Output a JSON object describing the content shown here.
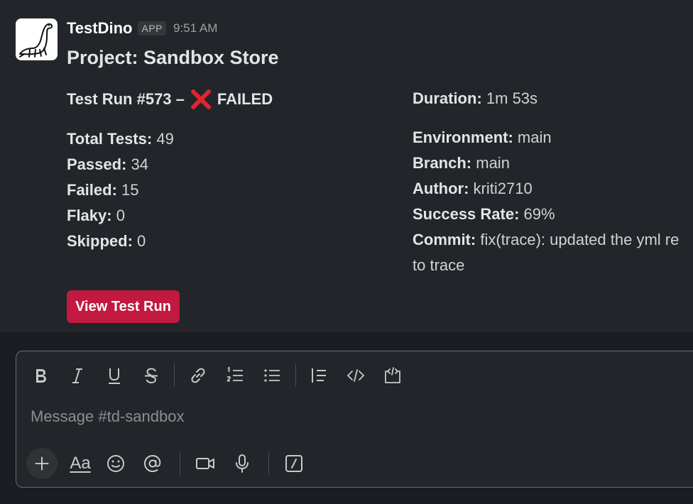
{
  "message": {
    "sender": "TestDino",
    "badge": "APP",
    "time": "9:51 AM",
    "title": "Project: Sandbox Store",
    "run": {
      "prefix": "Test Run #573 –",
      "status": "FAILED"
    },
    "left_fields": [
      {
        "label": "Total Tests:",
        "value": "49"
      },
      {
        "label": "Passed:",
        "value": "34"
      },
      {
        "label": "Failed:",
        "value": "15"
      },
      {
        "label": "Flaky:",
        "value": "0"
      },
      {
        "label": "Skipped:",
        "value": "0"
      }
    ],
    "duration": {
      "label": "Duration:",
      "value": "1m 53s"
    },
    "right_fields": [
      {
        "label": "Environment:",
        "value": "main"
      },
      {
        "label": "Branch:",
        "value": "main"
      },
      {
        "label": "Author:",
        "value": "kriti2710"
      },
      {
        "label": "Success Rate:",
        "value": "69%"
      },
      {
        "label": "Commit:",
        "value": "fix(trace): updated the yml re"
      }
    ],
    "commit_continued": "to trace",
    "button_label": "View Test Run"
  },
  "composer": {
    "placeholder": "Message #td-sandbox",
    "format_label": "Aa",
    "toolbar_icons": [
      "bold-icon",
      "italic-icon",
      "underline-icon",
      "strikethrough-icon",
      "link-icon",
      "ordered-list-icon",
      "bulleted-list-icon",
      "blockquote-icon",
      "code-icon",
      "code-block-icon"
    ],
    "bottom_icons": [
      "plus-icon",
      "text-format-icon",
      "emoji-icon",
      "mention-icon",
      "video-icon",
      "microphone-icon",
      "slash-command-icon"
    ]
  },
  "colors": {
    "background": "#1a1d21",
    "message_bg": "#222529",
    "button": "#c1193f",
    "fail_icon": "#e0242f"
  }
}
